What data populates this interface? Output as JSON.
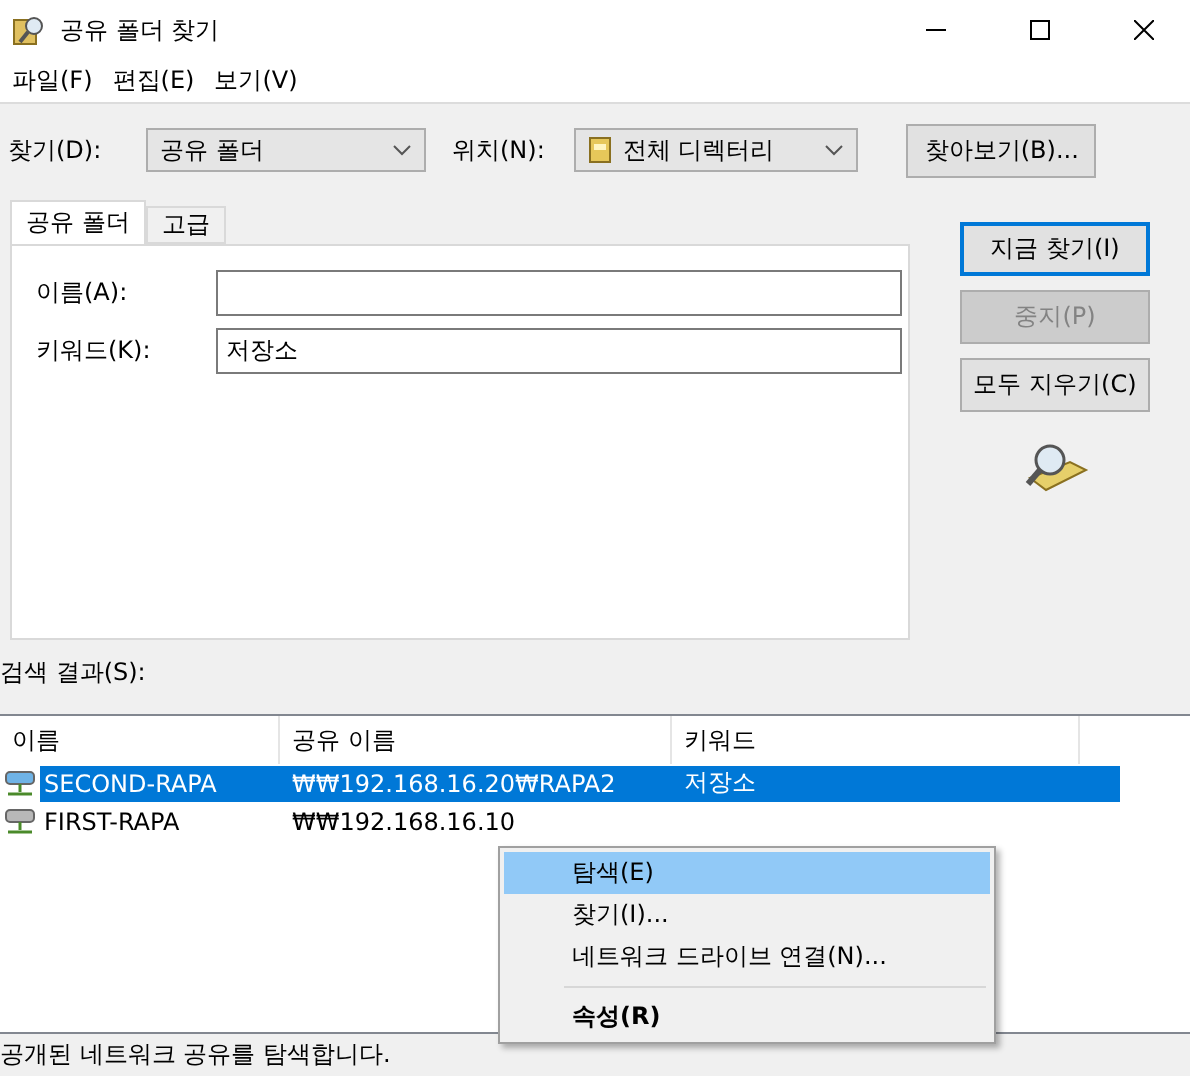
{
  "window": {
    "title": "공유 폴더 찾기"
  },
  "menu": [
    {
      "label": "파일(F)"
    },
    {
      "label": "편집(E)"
    },
    {
      "label": "보기(V)"
    }
  ],
  "find_bar": {
    "look_for_label": "찾기(D):",
    "look_for_value": "공유 폴더",
    "location_label": "위치(N):",
    "location_value": "전체 디렉터리",
    "browse_button": "찾아보기(B)..."
  },
  "tabs": [
    {
      "label": "공유 폴더",
      "selected": true
    },
    {
      "label": "고급",
      "selected": false
    }
  ],
  "fields": [
    {
      "label": "이름(A):"
    },
    {
      "label": "키워드(K):",
      "value": "저장소"
    }
  ],
  "actions": [
    {
      "label": "지금 찾기(I)",
      "default": true,
      "disabled": false
    },
    {
      "label": "중지(P)",
      "default": false,
      "disabled": true
    },
    {
      "label": "모두 지우기(C)",
      "default": false,
      "disabled": false
    }
  ],
  "results": {
    "label": "검색 결과(S):",
    "columns": [
      "이름",
      "공유 이름",
      "키워드"
    ],
    "rows": [
      {
        "name": "SECOND-RAPA",
        "share": "₩₩192.168.16.20₩RAPA2",
        "keyword": "저장소",
        "selected": true
      },
      {
        "name": "FIRST-RAPA",
        "share": "₩₩192.168.16.10",
        "selected": false
      }
    ]
  },
  "context_menu": {
    "items": [
      {
        "kind": "item",
        "label": "탐색(E)",
        "selected": true,
        "bold": false
      },
      {
        "kind": "item",
        "label": "찾기(I)...",
        "selected": false,
        "bold": false
      },
      {
        "kind": "item",
        "label": "네트워크 드라이브 연결(N)...",
        "selected": false,
        "bold": false
      },
      {
        "kind": "separator"
      },
      {
        "kind": "item",
        "label": "속성(R)",
        "selected": false,
        "bold": true
      }
    ]
  },
  "status_bar": "공개된 네트워크 공유를 탐색합니다."
}
